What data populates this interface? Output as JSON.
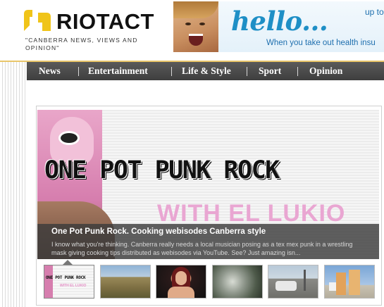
{
  "site": {
    "brand": "RIOTACT",
    "tagline": "\"CANBERRA NEWS, VIEWS AND OPINION\"",
    "brand_color": "#f0c419"
  },
  "ad": {
    "headline": "hello...",
    "side_text": "up to",
    "sub_text": "When you take out health insu"
  },
  "nav": {
    "items": [
      "News",
      "Entertainment",
      "Life & Style",
      "Sport",
      "Opinion"
    ]
  },
  "feature": {
    "hero_title": "ONE POT PUNK ROCK",
    "hero_subtitle": "WITH EL LUKIO",
    "title": "One Pot Punk Rock. Cooking webisodes Canberra style",
    "excerpt": "I know what you're thinking. Canberra really needs a local musician posing as a tex mex punk in a wrestling mask giving cooking tips distributed as webisodes via YouTube. See? Just amazing isn...",
    "thumbnail_title": "ONE POT PUNK ROCK",
    "thumbnail_subtitle": "WITH EL LUKIO"
  }
}
